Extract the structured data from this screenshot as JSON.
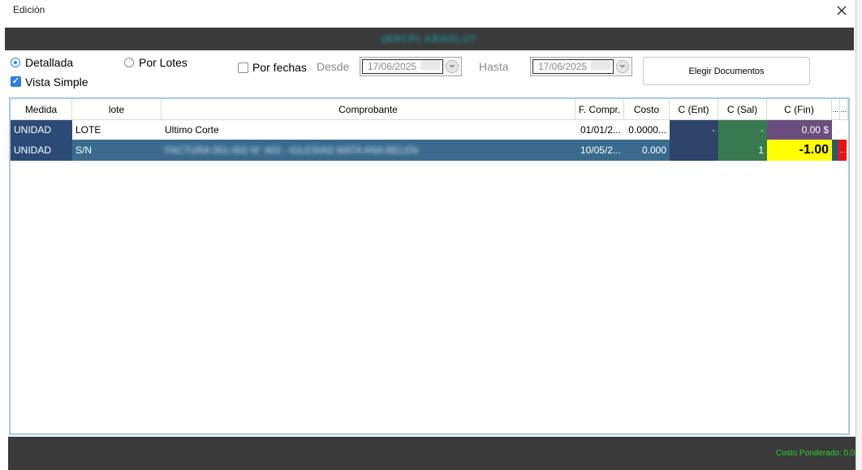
{
  "window": {
    "title": "Edición"
  },
  "product": {
    "name": "(BRCP) ABSOLUT"
  },
  "options": {
    "detallada": "Detallada",
    "por_lotes": "Por Lotes",
    "vista_simple": "Vista Simple",
    "por_fechas": "Por fechas",
    "desde": "Desde",
    "hasta": "Hasta",
    "desde_value": "17/06/2025",
    "hasta_value": "17/06/2025",
    "elegir_documentos": "Elegir Documentos"
  },
  "table": {
    "headers": [
      "Medida",
      "lote",
      "Comprobante",
      "F. Compr.",
      "Costo",
      "C (Ent)",
      "C (Sal)",
      "C (Fin)",
      "...",
      "..."
    ],
    "rows": [
      {
        "medida": "UNIDAD",
        "lote": "LOTE",
        "comprobante": "Ultimo Corte",
        "fecha": "01/01/2...",
        "costo": "0.0000...",
        "ent": "-",
        "sal": "-",
        "fin": "0.00 $",
        "extra": ""
      },
      {
        "medida": "UNIDAD",
        "lote": "S/N",
        "comprobante": "FACTURA 001-002 N° 402 - IGLESIAS MATA ANA BELEN",
        "fecha": "10/05/2...",
        "costo": "0.000",
        "ent": "",
        "sal": "1",
        "fin": "-1.00",
        "extra": "..."
      }
    ]
  },
  "footer": {
    "costo_ponderado": "Costo Ponderado: 0.0"
  },
  "colors": {
    "dark_bar": "#3a3a3a",
    "row_selected": "#3a6b8c",
    "medida_dark": "#2b4a78",
    "ent_col": "#2e4468",
    "sal_col": "#3a7a50",
    "fin_purple": "#6a4e80",
    "fin_yellow": "#ffff00",
    "alert_red": "#ee1111",
    "footer_text": "#27d32c"
  }
}
